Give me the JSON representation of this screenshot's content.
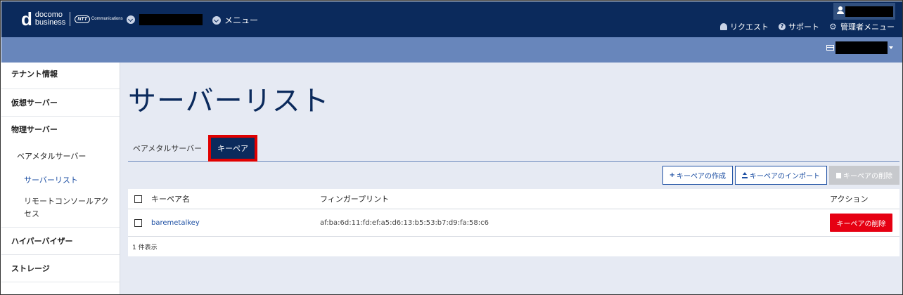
{
  "brand": {
    "logo_mark": "d",
    "logo_line1": "docomo",
    "logo_line2": "business",
    "partner": "NTT",
    "partner_sub": "Communications"
  },
  "header": {
    "menu_label": "メニュー",
    "links": [
      {
        "icon": "bell-icon",
        "label": "リクエスト"
      },
      {
        "icon": "help-icon",
        "label": "サポート"
      },
      {
        "icon": "gear-icon",
        "label": "管理者メニュー"
      }
    ]
  },
  "sidebar": {
    "items": [
      {
        "label": "テナント情報"
      },
      {
        "label": "仮想サーバー"
      },
      {
        "label": "物理サーバー"
      }
    ],
    "sub_group": "ベアメタルサーバー",
    "sub_items": [
      {
        "label": "サーバーリスト"
      },
      {
        "label": "リモートコンソールアクセス"
      }
    ],
    "bottom_items": [
      {
        "label": "ハイパーバイザー"
      },
      {
        "label": "ストレージ"
      }
    ]
  },
  "main": {
    "title": "サーバーリスト",
    "tabs": [
      {
        "label": "ベアメタルサーバー"
      },
      {
        "label": "キーペア"
      }
    ],
    "actions": {
      "create": "キーペアの作成",
      "import": "キーペアのインポート",
      "delete": "キーペアの削除"
    },
    "table": {
      "columns": [
        "キーペア名",
        "フィンガープリント",
        "アクション"
      ],
      "rows": [
        {
          "name": "baremetalkey",
          "fingerprint": "af:ba:6d:11:fd:ef:a5:d6:13:b5:53:b7:d9:fa:58:c6",
          "action": "キーペアの削除"
        }
      ],
      "count": "1 件表示"
    }
  },
  "colors": {
    "header_bg": "#0b2a5c",
    "subbar_bg": "#6886bb",
    "content_bg": "#e6eaf3",
    "link": "#1d4fa3",
    "danger": "#e60012",
    "highlight": "#e00000"
  }
}
